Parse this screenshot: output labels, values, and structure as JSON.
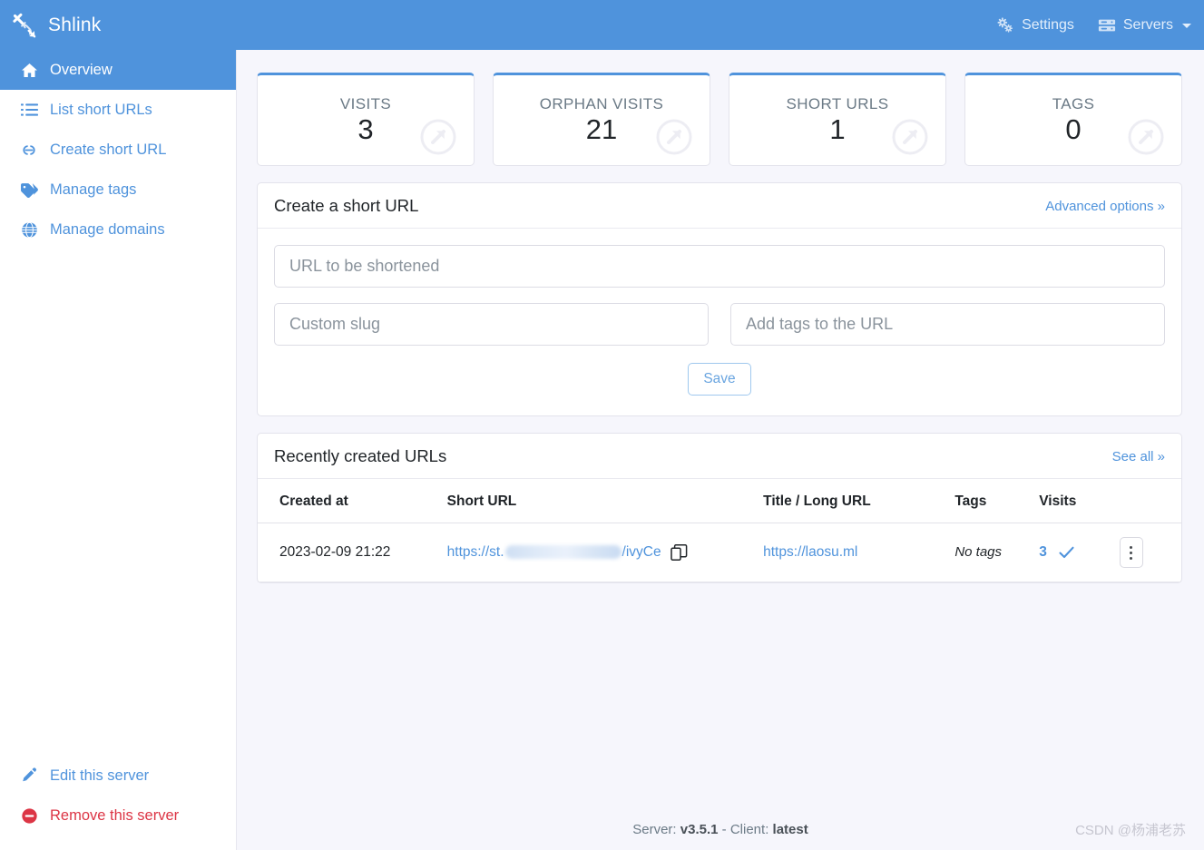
{
  "header": {
    "brand": "Shlink",
    "brand_icon": "link-arrow-icon",
    "nav": [
      {
        "label": "Settings",
        "icon": "gears-icon",
        "has_caret": false
      },
      {
        "label": "Servers",
        "icon": "server-rack-icon",
        "has_caret": true
      }
    ]
  },
  "sidebar": {
    "items": [
      {
        "label": "Overview",
        "icon": "home-icon",
        "active": true
      },
      {
        "label": "List short URLs",
        "icon": "list-icon",
        "active": false
      },
      {
        "label": "Create short URL",
        "icon": "link-icon",
        "active": false
      },
      {
        "label": "Manage tags",
        "icon": "tag-icon",
        "active": false
      },
      {
        "label": "Manage domains",
        "icon": "globe-icon",
        "active": false
      }
    ],
    "bottom_items": [
      {
        "label": "Edit this server",
        "icon": "pencil-icon",
        "style": "link"
      },
      {
        "label": "Remove this server",
        "icon": "minus-circle-icon",
        "style": "danger"
      }
    ]
  },
  "stats": [
    {
      "label": "VISITS",
      "value": "3"
    },
    {
      "label": "ORPHAN VISITS",
      "value": "21"
    },
    {
      "label": "SHORT URLS",
      "value": "1"
    },
    {
      "label": "TAGS",
      "value": "0"
    }
  ],
  "create_panel": {
    "title": "Create a short URL",
    "advanced_link": "Advanced options »",
    "url_placeholder": "URL to be shortened",
    "url_value": "",
    "slug_placeholder": "Custom slug",
    "slug_value": "",
    "tags_placeholder": "Add tags to the URL",
    "tags_value": "",
    "save_label": "Save"
  },
  "recent_panel": {
    "title": "Recently created URLs",
    "see_all_link": "See all »",
    "columns": [
      "Created at",
      "Short URL",
      "Title  /  Long URL",
      "Tags",
      "Visits",
      ""
    ],
    "rows": [
      {
        "created_at": "2023-02-09 21:22",
        "short_url_prefix": "https://st.",
        "short_url_redacted": true,
        "short_url_suffix": "/ivyCe",
        "copy_icon": "copy-icon",
        "long_url": "https://laosu.ml",
        "tags": "No tags",
        "visits": "3",
        "status_icon": "check-icon",
        "menu_icon": "ellipsis-vertical-icon"
      }
    ]
  },
  "footer": {
    "server_label": "Server:",
    "server_version": "v3.5.1",
    "separator": "-",
    "client_label": "Client:",
    "client_version": "latest"
  },
  "watermark": "CSDN @杨浦老苏",
  "colors": {
    "brand_blue": "#4f93dc",
    "page_bg": "#f6f6fc",
    "danger_red": "#dc3545",
    "link_blue": "#4f93dc"
  }
}
